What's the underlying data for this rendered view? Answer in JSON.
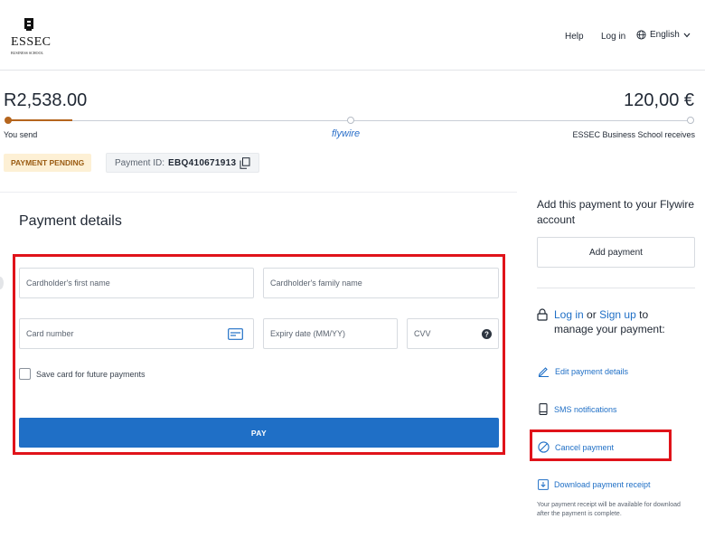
{
  "header": {
    "logo_text": "ESSEC",
    "logo_subtext": "BUSINESS SCHOOL",
    "help_label": "Help",
    "login_label": "Log in",
    "language_label": "English"
  },
  "transfer": {
    "send_amount": "R2,538.00",
    "receive_amount": "120,00 €",
    "send_label": "You send",
    "provider_label": "flywire",
    "receive_label": "ESSEC Business School receives",
    "progress_step": 1,
    "progress_steps_total": 3
  },
  "status": {
    "badge": "PAYMENT PENDING",
    "payment_id_label": "Payment ID:",
    "payment_id_value": "EBQ410671913"
  },
  "payment_form": {
    "title": "Payment details",
    "first_name_placeholder": "Cardholder's first name",
    "family_name_placeholder": "Cardholder's family name",
    "card_number_placeholder": "Card number",
    "expiry_placeholder": "Expiry date (MM/YY)",
    "cvv_placeholder": "CVV",
    "save_card_label": "Save card for future payments",
    "pay_label": "PAY"
  },
  "sidebar": {
    "add_heading": "Add this payment to your Flywire account",
    "add_button_label": "Add payment",
    "login_link": "Log in",
    "login_or": "or",
    "signup_link": "Sign up",
    "login_suffix": "to manage your payment:",
    "edit_label": "Edit payment details",
    "sms_label": "SMS notifications",
    "cancel_label": "Cancel payment",
    "download_label": "Download payment receipt",
    "receipt_note": "Your payment receipt will be available for download after the payment is complete."
  },
  "colors": {
    "accent_blue": "#1f6fc6",
    "progress_brown": "#b5651d",
    "highlight_red": "#e0131a",
    "badge_bg": "#fdf0d5"
  }
}
